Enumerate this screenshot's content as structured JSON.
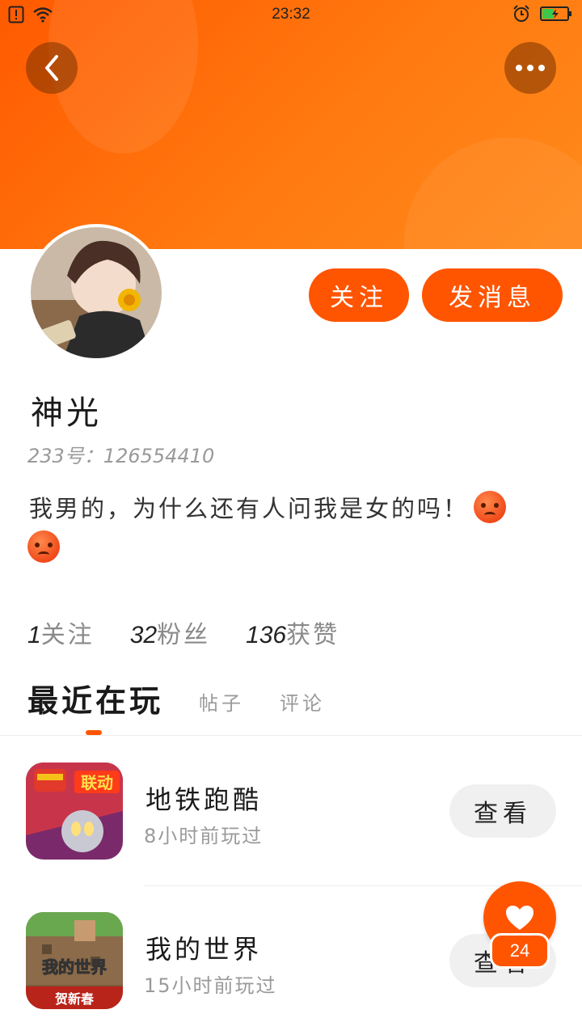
{
  "status_bar": {
    "time": "23:32"
  },
  "profile": {
    "username": "神光",
    "user_id": "233号：126554410",
    "bio": "我男的，为什么还有人问我是女的吗！",
    "actions": {
      "follow": "关注",
      "message": "发消息"
    }
  },
  "stats": [
    {
      "num": "1",
      "label": "关注"
    },
    {
      "num": "32",
      "label": "粉丝"
    },
    {
      "num": "136",
      "label": "获赞"
    }
  ],
  "tabs": {
    "active": "最近在玩",
    "posts": "帖子",
    "comments": "评论"
  },
  "games": [
    {
      "title": "地铁跑酷",
      "subtitle": "8小时前玩过",
      "button": "查看",
      "badge": "联动"
    },
    {
      "title": "我的世界",
      "subtitle": "15小时前玩过",
      "button": "查看",
      "icon_text": "我的世界",
      "banner": "贺新春"
    }
  ],
  "like": {
    "count": "24"
  },
  "colors": {
    "accent": "#ff5500",
    "banner": "#ff7a10"
  }
}
